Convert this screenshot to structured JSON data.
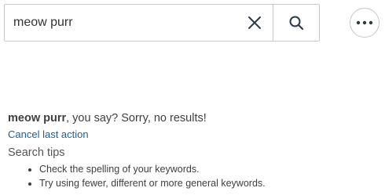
{
  "search": {
    "value": "meow purr",
    "clear_icon": "close-icon",
    "search_icon": "search-icon"
  },
  "more_menu": {
    "icon": "more-horizontal-icon"
  },
  "results": {
    "query": "meow purr",
    "message": ", you say? Sorry, no results!",
    "cancel_label": "Cancel last action",
    "tips_heading": "Search tips",
    "tips": [
      "Check the spelling of your keywords.",
      "Try using fewer, different or more general keywords."
    ]
  },
  "colors": {
    "link": "#1a5e98",
    "border": "#c9c9c9",
    "icon": "#2b3a4a",
    "text": "#3f3f3f"
  }
}
